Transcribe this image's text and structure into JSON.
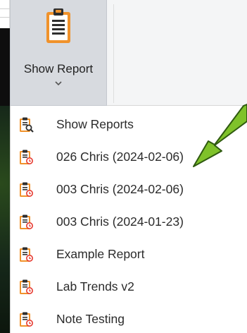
{
  "ribbon": {
    "show_report_label": "Show Report",
    "icons": {
      "main": "clipboard-report-icon",
      "dropdown": "chevron-down-icon"
    }
  },
  "menu": {
    "items": [
      {
        "label": "Show Reports",
        "icon": "report-search-icon"
      },
      {
        "label": "026 Chris (2024-02-06)",
        "icon": "report-clock-icon"
      },
      {
        "label": "003 Chris (2024-02-06)",
        "icon": "report-clock-icon"
      },
      {
        "label": "003 Chris (2024-01-23)",
        "icon": "report-clock-icon"
      },
      {
        "label": "Example Report",
        "icon": "report-clock-icon"
      },
      {
        "label": "Lab Trends v2",
        "icon": "report-clock-icon"
      },
      {
        "label": "Note Testing",
        "icon": "report-clock-icon"
      }
    ]
  },
  "colors": {
    "accent_orange": "#f0922b",
    "clock_red": "#e6392f",
    "arrow_green": "#7fc22a",
    "button_active_bg": "#d7dadf"
  }
}
